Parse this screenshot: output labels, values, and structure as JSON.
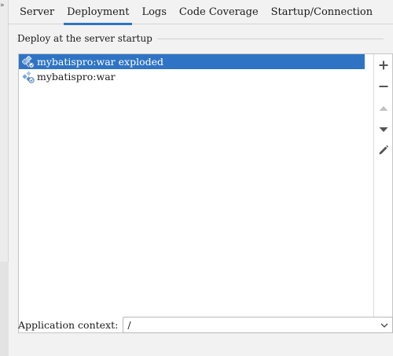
{
  "gutter": {
    "collapse_glyph": "»"
  },
  "tabs": [
    {
      "label": "Server",
      "active": false
    },
    {
      "label": "Deployment",
      "active": true
    },
    {
      "label": "Logs",
      "active": false
    },
    {
      "label": "Code Coverage",
      "active": false
    },
    {
      "label": "Startup/Connection",
      "active": false
    }
  ],
  "deploy_group": {
    "title": "Deploy at the server startup",
    "artifacts": [
      {
        "label": "mybatispro:war exploded",
        "icon": "artifact-icon",
        "selected": true
      },
      {
        "label": "mybatispro:war",
        "icon": "artifact-icon",
        "selected": false
      }
    ]
  },
  "toolbar": {
    "add": "plus-icon",
    "remove": "minus-icon",
    "move_up": "arrow-up-icon",
    "move_down": "arrow-down-icon",
    "edit": "pencil-icon"
  },
  "context": {
    "label": "Application context:",
    "value": "/"
  },
  "colors": {
    "accent": "#2f74c4",
    "selection_text": "#ffffff",
    "background": "#f2f2f2"
  }
}
